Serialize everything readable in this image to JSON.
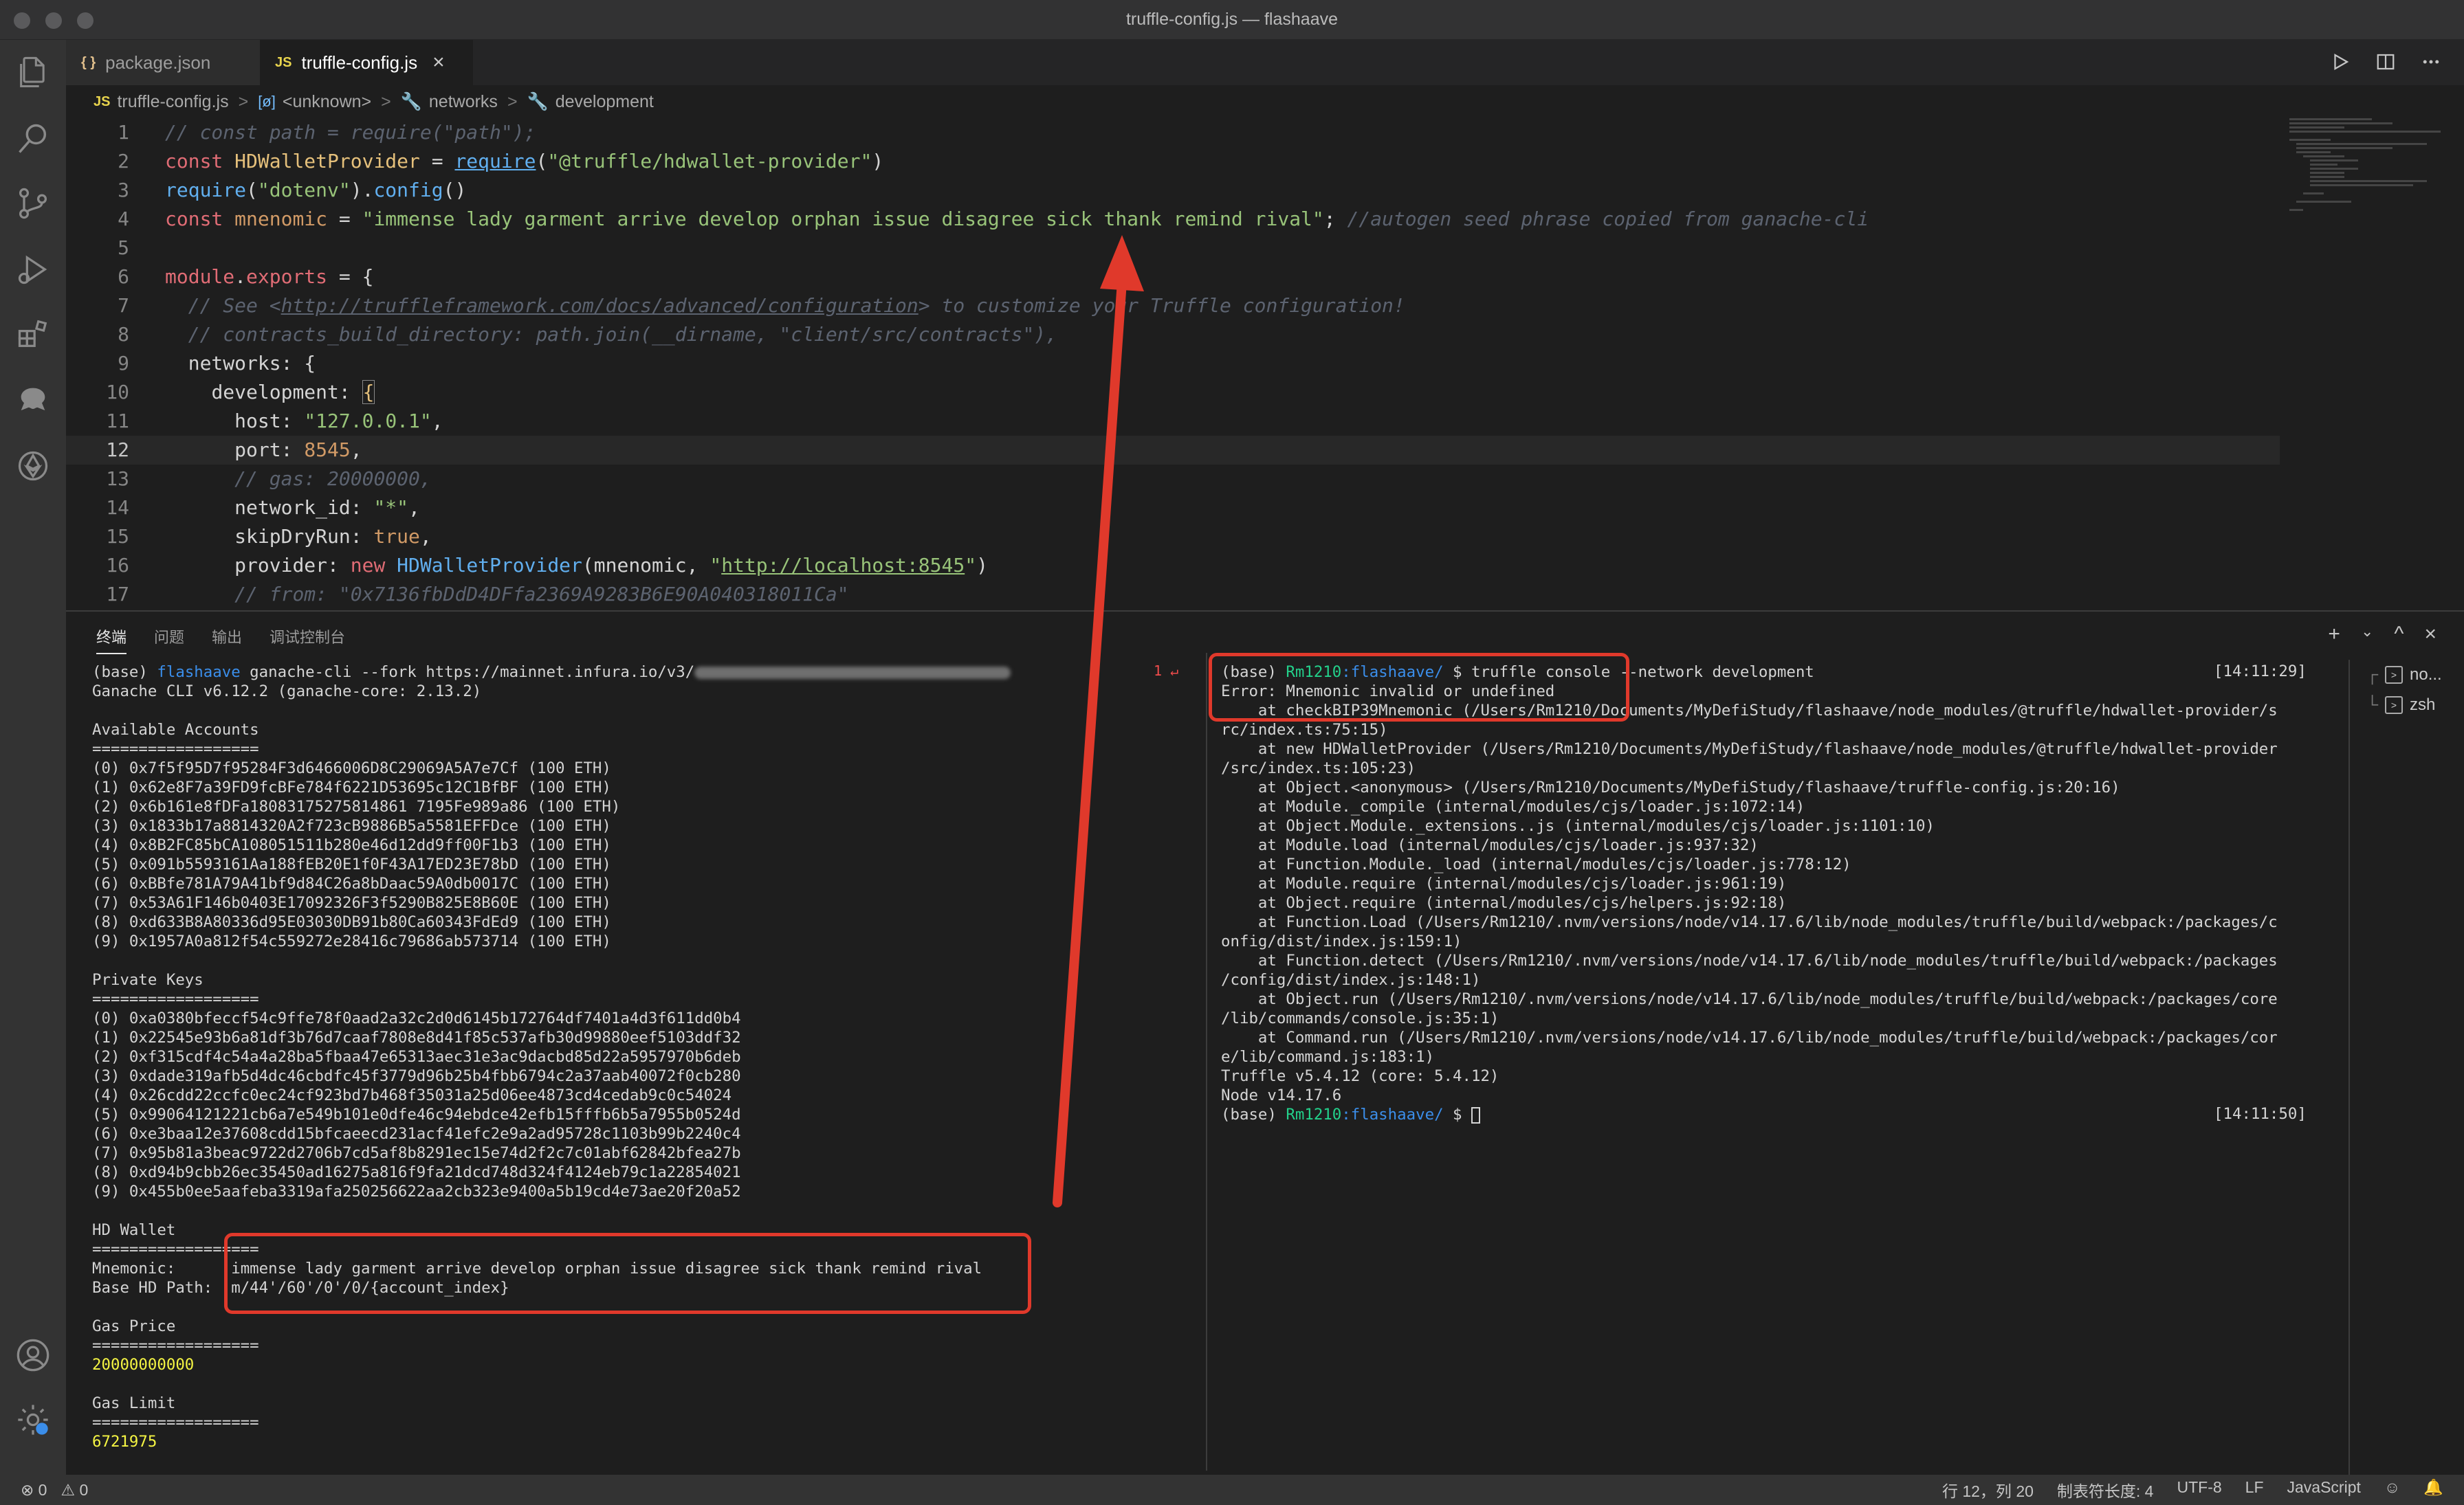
{
  "window": {
    "title": "truffle-config.js — flashaave"
  },
  "tabs": [
    {
      "icon": "{ }",
      "label": "package.json"
    },
    {
      "icon": "JS",
      "label": "truffle-config.js",
      "close": "×"
    }
  ],
  "breadcrumb": {
    "file_icon": "JS",
    "items": [
      "truffle-config.js",
      "<unknown>",
      "networks",
      "development"
    ],
    "separator": ">"
  },
  "editor": {
    "current_line": 12,
    "line_numbers": [
      "1",
      "2",
      "3",
      "4",
      "5",
      "6",
      "7",
      "8",
      "9",
      "10",
      "11",
      "12",
      "13",
      "14",
      "15",
      "16",
      "17"
    ]
  },
  "panel": {
    "tabs": [
      "终端",
      "问题",
      "输出",
      "调试控制台"
    ],
    "actions": [
      "+",
      "⌄",
      "^",
      "×"
    ],
    "terminal_list": [
      "no...",
      "zsh"
    ],
    "marker": "1 ↵"
  },
  "terminal_left": {
    "prompt_base": "(base) ",
    "prompt_dir": "flashaave",
    "command": " ganache-cli --fork https://mainnet.infura.io/v3/",
    "version": "Ganache CLI v6.12.2 (ganache-core: 2.13.2)",
    "accounts_title": "Available Accounts",
    "rule": "==================",
    "accounts": [
      "(0) 0x7f5f95D7f95284F3d6466006D8C29069A5A7e7Cf (100 ETH)",
      "(1) 0x62e8F7a39FD9fcBFe784f6221D53695c12C1BfBF (100 ETH)",
      "(2) 0x6b161e8fDFa18083175275814861 7195Fe989a86 (100 ETH)",
      "(3) 0x1833b17a8814320A2f723cB9886B5a5581EFFDce (100 ETH)",
      "(4) 0x8B2FC85bCA108051511b280e46d12dd9ff00F1b3 (100 ETH)",
      "(5) 0x091b5593161Aa188fEB20E1f0F43A17ED23E78bD (100 ETH)",
      "(6) 0xBBfe781A79A41bf9d84C26a8bDaac59A0db0017C (100 ETH)",
      "(7) 0x53A61F146b0403E17092326F3f5290B825E8B60E (100 ETH)",
      "(8) 0xd633B8A80336d95E03030DB91b80Ca60343FdEd9 (100 ETH)",
      "(9) 0x1957A0a812f54c559272e28416c79686ab573714 (100 ETH)"
    ],
    "keys_title": "Private Keys",
    "keys": [
      "(0) 0xa0380bfeccf54c9ffe78f0aad2a32c2d0d6145b172764df7401a4d3f611dd0b4",
      "(1) 0x22545e93b6a81df3b76d7caaf7808e8d41f85c537afb30d99880eef5103ddf32",
      "(2) 0xf315cdf4c54a4a28ba5fbaa47e65313aec31e3ac9dacbd85d22a5957970b6deb",
      "(3) 0xdade319afb5d4dc46cbdfc45f3779d96b25b4fbb6794c2a37aab40072f0cb280",
      "(4) 0x26cdd22ccfc0ec24cf923bd7b468f35031a25d06ee4873cd4cedab9c0c54024",
      "(5) 0x99064121221cb6a7e549b101e0dfe46c94ebdce42efb15fffb6b5a7955b0524d",
      "(6) 0xe3baa12e37608cdd15bfcaeecd231acf41efc2e9a2ad95728c1103b99b2240c4",
      "(7) 0x95b81a3beac9722d2706b7cd5af8b8291ec15e74d2f2c7c01abf62842bfea27b",
      "(8) 0xd94b9cbb26ec35450ad16275a816f9fa21dcd748d324f4124eb79c1a22854021",
      "(9) 0x455b0ee5aafeba3319afa250256622aa2cb323e9400a5b19cd4e73ae20f20a52"
    ],
    "hd_title": "HD Wallet",
    "mnemonic_label": "Mnemonic:      ",
    "mnemonic_value": "immense lady garment arrive develop orphan issue disagree sick thank remind rival",
    "path_label": "Base HD Path:  ",
    "path_value": "m/44'/60'/0'/0/{account_index}",
    "gas_price_title": "Gas Price",
    "gas_price": "20000000000",
    "gas_limit_title": "Gas Limit",
    "gas_limit": "6721975"
  },
  "terminal_right": {
    "prompt_base": "(base) ",
    "user": "Rm1210",
    "dir": ":flashaave/",
    "cmd1": " $ truffle console --network development",
    "time1": "[14:11:29]",
    "lines": [
      "Error: Mnemonic invalid or undefined",
      "    at checkBIP39Mnemonic (/Users/Rm1210/Documents/MyDefiStudy/flashaave/node_modules/@truffle/hdwallet-provider/s",
      "rc/index.ts:75:15)",
      "    at new HDWalletProvider (/Users/Rm1210/Documents/MyDefiStudy/flashaave/node_modules/@truffle/hdwallet-provider",
      "/src/index.ts:105:23)",
      "    at Object.<anonymous> (/Users/Rm1210/Documents/MyDefiStudy/flashaave/truffle-config.js:20:16)",
      "    at Module._compile (internal/modules/cjs/loader.js:1072:14)",
      "    at Object.Module._extensions..js (internal/modules/cjs/loader.js:1101:10)",
      "    at Module.load (internal/modules/cjs/loader.js:937:32)",
      "    at Function.Module._load (internal/modules/cjs/loader.js:778:12)",
      "    at Module.require (internal/modules/cjs/loader.js:961:19)",
      "    at Object.require (internal/modules/cjs/helpers.js:92:18)",
      "    at Function.Load (/Users/Rm1210/.nvm/versions/node/v14.17.6/lib/node_modules/truffle/build/webpack:/packages/c",
      "onfig/dist/index.js:159:1)",
      "    at Function.detect (/Users/Rm1210/.nvm/versions/node/v14.17.6/lib/node_modules/truffle/build/webpack:/packages",
      "/config/dist/index.js:148:1)",
      "    at Object.run (/Users/Rm1210/.nvm/versions/node/v14.17.6/lib/node_modules/truffle/build/webpack:/packages/core",
      "/lib/commands/console.js:35:1)",
      "    at Command.run (/Users/Rm1210/.nvm/versions/node/v14.17.6/lib/node_modules/truffle/build/webpack:/packages/cor",
      "e/lib/command.js:183:1)",
      "Truffle v5.4.12 (core: 5.4.12)",
      "Node v14.17.6"
    ],
    "cmd2": " $ ",
    "time2": "[14:11:50]"
  },
  "statusbar": {
    "errors": "⊗ 0",
    "warnings": "⚠ 0",
    "position": "行 12，列 20",
    "indent": "制表符长度: 4",
    "encoding": "UTF-8",
    "eol": "LF",
    "language": "JavaScript"
  },
  "colors": {
    "annotation": "#e0392b",
    "accent": "#3b8eea"
  }
}
